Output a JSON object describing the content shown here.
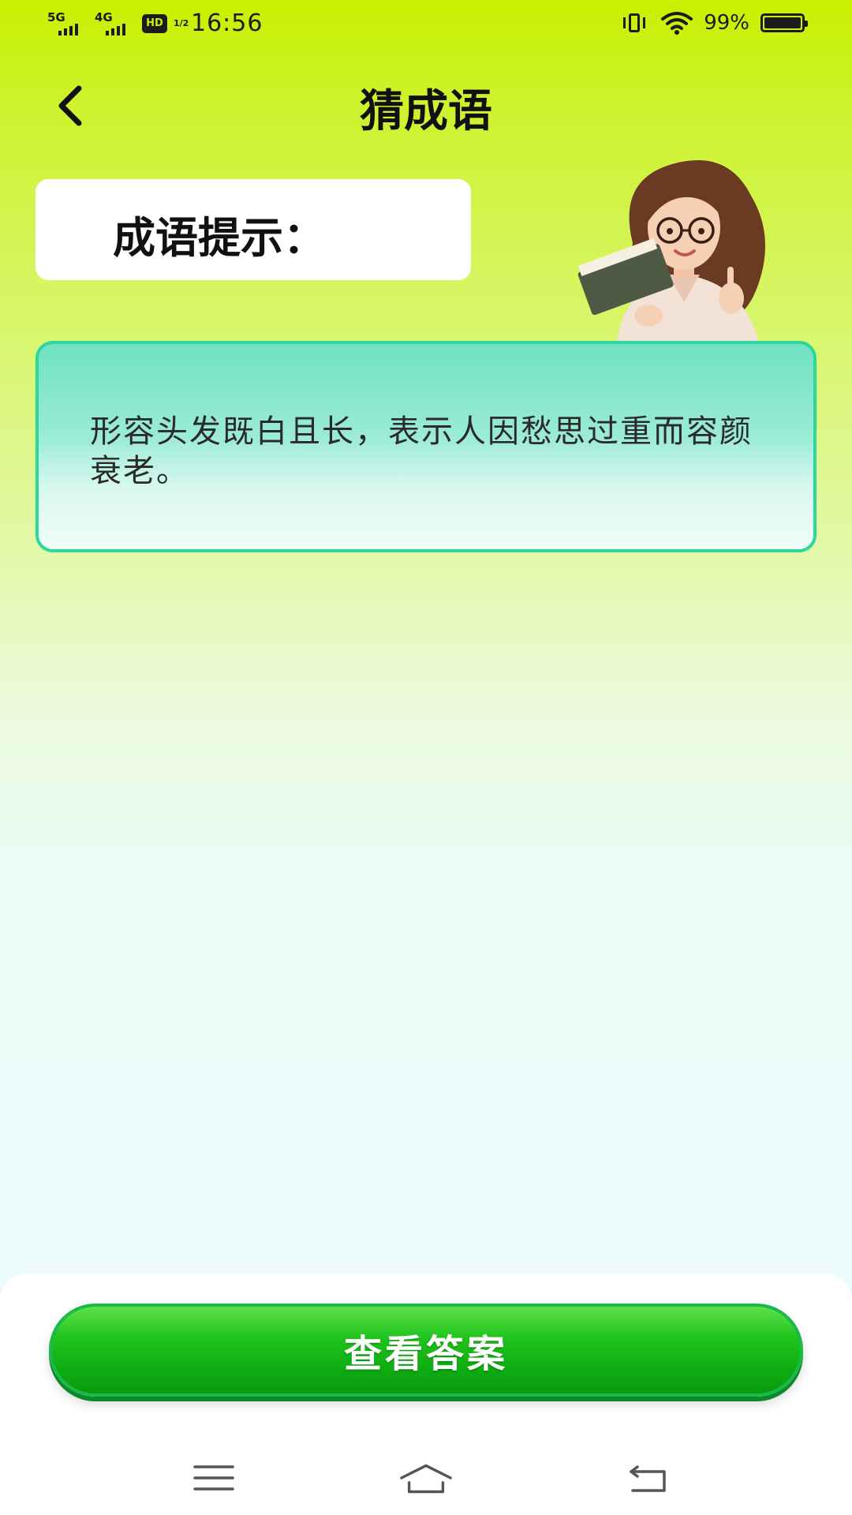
{
  "status_bar": {
    "net1": "5G",
    "net2": "4G",
    "hd": "HD",
    "hd_sub": "1/2",
    "time": "16:56",
    "battery_pct": "99%",
    "battery_level": 0.99
  },
  "header": {
    "title": "猜成语",
    "back_icon": "chevron-left-icon"
  },
  "hint": {
    "label": "成语提示：",
    "clue": "形容头发既白且长，表示人因愁思过重而容颜衰老。"
  },
  "actions": {
    "view_answer_label": "查看答案"
  },
  "nav_bar": {
    "menu_icon": "menu-icon",
    "home_icon": "home-icon",
    "back_icon": "back-icon"
  },
  "colors": {
    "header_bg": "#c8f000",
    "card_border": "#2bd79a",
    "button_green": "#1bb94a"
  }
}
